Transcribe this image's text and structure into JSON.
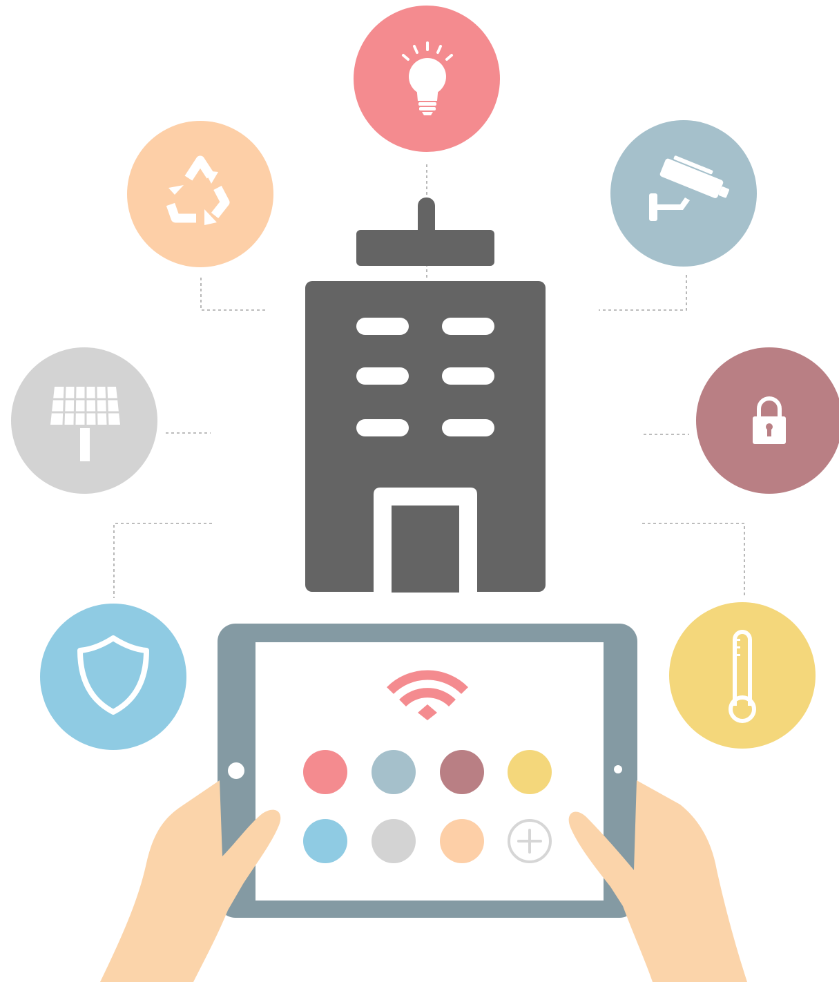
{
  "colors": {
    "background": "#ffffff",
    "building": "#646464",
    "tablet_frame": "#849aa3",
    "tablet_screen": "#ffffff",
    "hand": "#fbd4aa",
    "connector": "#a6a6a6",
    "lighting": "#f48b8f",
    "recycling": "#fdcfa7",
    "camera": "#a5c0cb",
    "solar": "#d3d3d3",
    "lock": "#b97f84",
    "shield": "#8fcbe3",
    "thermometer": "#f4d77b",
    "wifi": "#f48b8f",
    "add": "#d6d6d6"
  },
  "feature_icons": [
    "lightbulb-icon",
    "recycle-icon",
    "security-camera-icon",
    "solar-panel-icon",
    "lock-icon",
    "shield-icon",
    "thermometer-icon"
  ],
  "tablet": {
    "status_icon": "wifi-icon",
    "app_dots": [
      "lighting",
      "camera",
      "lock",
      "thermometer",
      "shield",
      "solar",
      "recycling",
      "add"
    ],
    "add_icon": "plus-icon"
  }
}
